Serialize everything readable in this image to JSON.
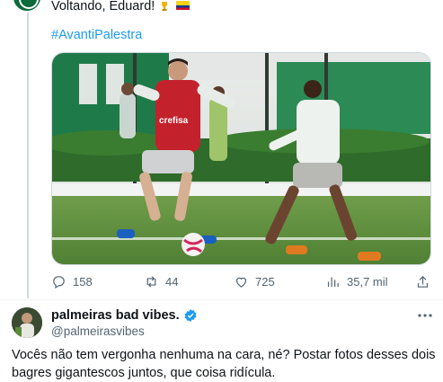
{
  "tweet": {
    "text": "Voltando, Eduard!",
    "hashtag": "#AvantiPalestra",
    "image_alt": "Two Palmeiras players training with a ball",
    "sponsor_text": "crefisa",
    "actions": {
      "replies": "158",
      "retweets": "44",
      "likes": "725",
      "views": "35,7 mil"
    }
  },
  "reply": {
    "author_name": "palmeiras bad vibes.",
    "author_handle": "@palmeirasvibes",
    "text": "Vocês não tem vergonha nenhuma na cara, né? Postar fotos desses dois bagres gigantescos juntos, que coisa ridícula."
  },
  "colors": {
    "link": "#1d9bf0",
    "muted": "#536471",
    "palmeiras_green": "#0b6b3a"
  }
}
